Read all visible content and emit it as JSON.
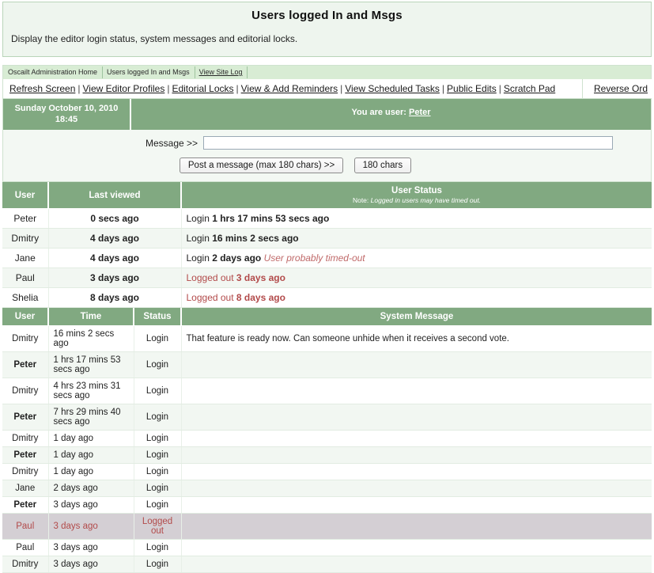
{
  "header": {
    "title": "Users logged In and Msgs",
    "subtitle": "Display the editor login status, system messages and editorial locks."
  },
  "breadcrumb": {
    "items": [
      {
        "label": "Oscailt Administration Home",
        "link": false
      },
      {
        "label": "Users logged In and Msgs",
        "link": false
      },
      {
        "label": "View Site Log",
        "link": true
      }
    ]
  },
  "nav": {
    "links": [
      "Refresh Screen",
      "View Editor Profiles",
      "Editorial Locks",
      "View & Add Reminders",
      "View Scheduled Tasks",
      "Public Edits",
      "Scratch Pad"
    ],
    "separator": "|",
    "right_link": "Reverse Ord"
  },
  "strip": {
    "date": "Sunday October 10, 2010",
    "time": "18:45",
    "user_prefix": "You are user:",
    "user_name": "Peter"
  },
  "message_form": {
    "label": "Message >>",
    "value": "",
    "placeholder": "",
    "post_button": "Post a message  (max 180 chars)  >>",
    "chars_button": "180 chars"
  },
  "user_status_table": {
    "columns": [
      "User",
      "Last viewed",
      "User Status"
    ],
    "status_note_prefix": "Note:",
    "status_note": "Logged in users may have timed out.",
    "rows": [
      {
        "user": "Peter",
        "last_viewed": "0 secs ago",
        "status_prefix": "Login",
        "status_value": "1 hrs 17 mins 53 secs ago",
        "status_suffix": "",
        "logged_out": false
      },
      {
        "user": "Dmitry",
        "last_viewed": "4 days ago",
        "status_prefix": "Login",
        "status_value": "16 mins 2 secs ago",
        "status_suffix": "",
        "logged_out": false
      },
      {
        "user": "Jane",
        "last_viewed": "4 days ago",
        "status_prefix": "Login",
        "status_value": "2 days ago",
        "status_suffix": "User probably timed-out",
        "logged_out": false
      },
      {
        "user": "Paul",
        "last_viewed": "3 days ago",
        "status_prefix": "Logged out",
        "status_value": "3 days ago",
        "status_suffix": "",
        "logged_out": true
      },
      {
        "user": "Shelia",
        "last_viewed": "8 days ago",
        "status_prefix": "Logged out",
        "status_value": "8 days ago",
        "status_suffix": "",
        "logged_out": true
      }
    ]
  },
  "system_message_table": {
    "columns": [
      "User",
      "Time",
      "Status",
      "System Message"
    ],
    "rows": [
      {
        "user": "Dmitry",
        "bold": false,
        "time": "16 mins 2 secs ago",
        "status": "Login",
        "message": "That feature is ready now. Can someone unhide when it receives a second vote.",
        "highlight": false
      },
      {
        "user": "Peter",
        "bold": true,
        "time": "1 hrs 17 mins 53 secs ago",
        "status": "Login",
        "message": "",
        "highlight": false
      },
      {
        "user": "Dmitry",
        "bold": false,
        "time": "4 hrs 23 mins 31 secs ago",
        "status": "Login",
        "message": "",
        "highlight": false
      },
      {
        "user": "Peter",
        "bold": true,
        "time": "7 hrs 29 mins 40 secs ago",
        "status": "Login",
        "message": "",
        "highlight": false
      },
      {
        "user": "Dmitry",
        "bold": false,
        "time": "1 day ago",
        "status": "Login",
        "message": "",
        "highlight": false
      },
      {
        "user": "Peter",
        "bold": true,
        "time": "1 day ago",
        "status": "Login",
        "message": "",
        "highlight": false
      },
      {
        "user": "Dmitry",
        "bold": false,
        "time": "1 day ago",
        "status": "Login",
        "message": "",
        "highlight": false
      },
      {
        "user": "Jane",
        "bold": false,
        "time": "2 days ago",
        "status": "Login",
        "message": "",
        "highlight": false
      },
      {
        "user": "Peter",
        "bold": true,
        "time": "3 days ago",
        "status": "Login",
        "message": "",
        "highlight": false
      },
      {
        "user": "Paul",
        "bold": false,
        "time": "3 days ago",
        "status": "Logged out",
        "message": "",
        "highlight": true
      },
      {
        "user": "Paul",
        "bold": false,
        "time": "3 days ago",
        "status": "Login",
        "message": "",
        "highlight": false
      },
      {
        "user": "Dmitry",
        "bold": false,
        "time": "3 days ago",
        "status": "Login",
        "message": "",
        "highlight": false
      }
    ]
  },
  "colors": {
    "header_green": "#81a981",
    "panel_green": "#eef5ee",
    "breadcrumb_green": "#d8ecd4",
    "alt_row": "#f2f7f2",
    "highlight_row": "#d4cfd4",
    "red_text": "#b24a4a"
  }
}
